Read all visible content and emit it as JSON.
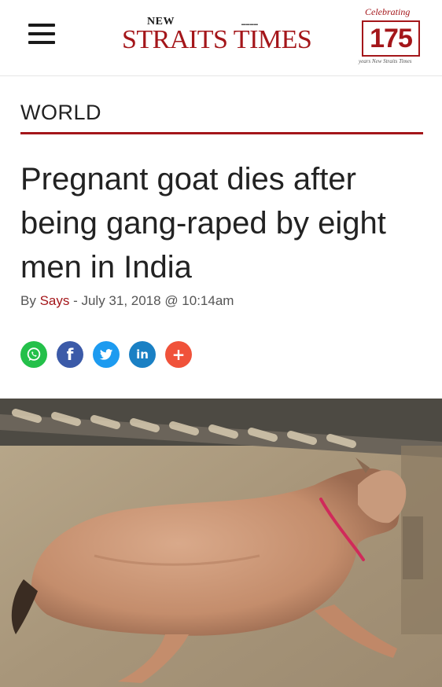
{
  "header": {
    "logo_new": "NEW",
    "logo_main": "STRAITS TIMES",
    "badge_top": "Celebrating",
    "badge_number": "175",
    "badge_bottom": "years New Straits Times"
  },
  "article": {
    "section": "WORLD",
    "headline": "Pregnant goat dies after being gang-raped by eight men in India",
    "byline_prefix": "By ",
    "author": "Says",
    "byline_date": " - July 31, 2018 @ 10:14am"
  },
  "share": {
    "whatsapp_icon": "whatsapp-icon",
    "facebook_icon": "f",
    "twitter_icon": "twitter-bird-icon",
    "linkedin_icon": "in",
    "more_icon": "+"
  },
  "colors": {
    "brand_red": "#a4161a",
    "whatsapp": "#24c04a",
    "facebook": "#3b5aa8",
    "twitter": "#1d9bf0",
    "linkedin": "#1a80c4",
    "more": "#f0523a"
  }
}
